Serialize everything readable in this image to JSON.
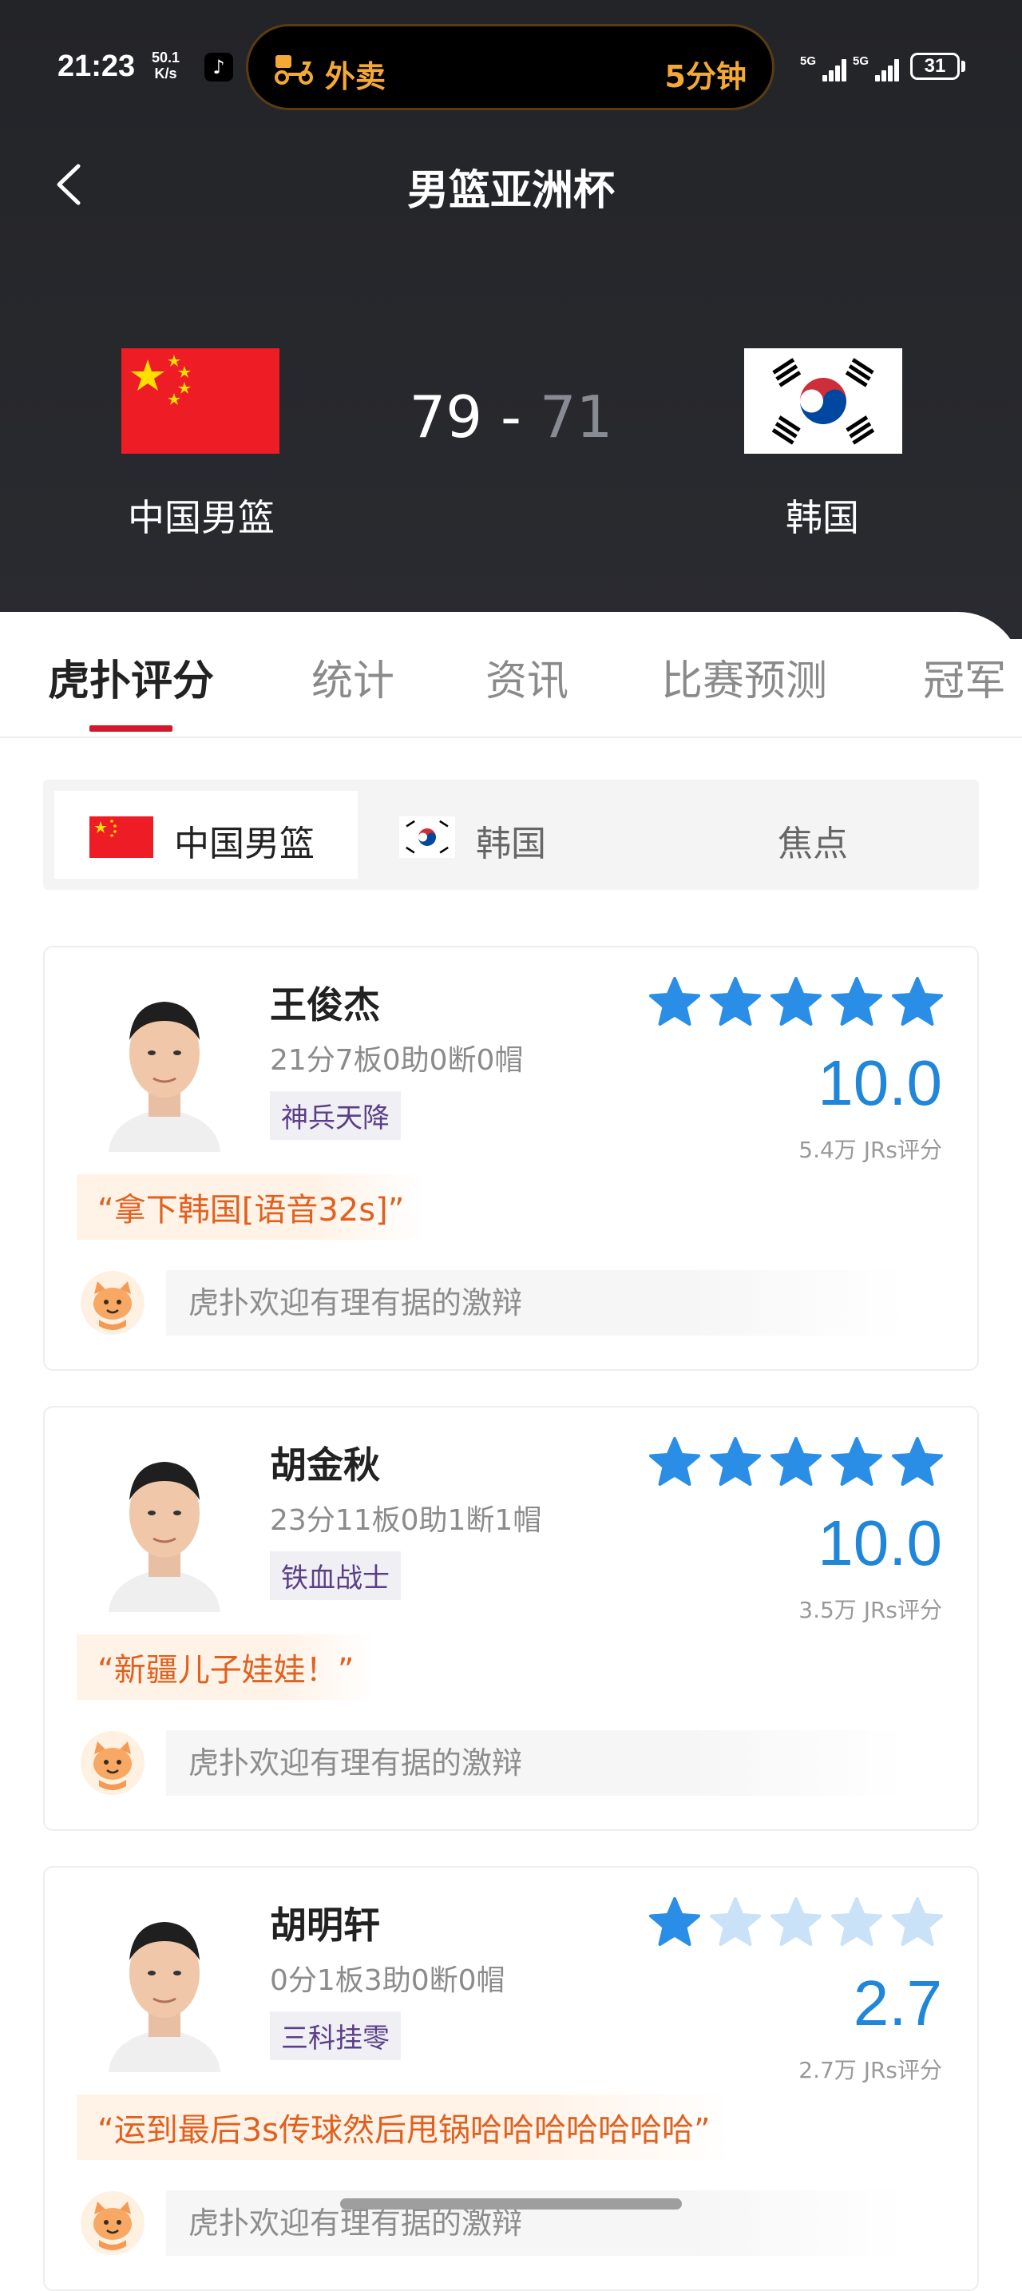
{
  "status_bar": {
    "time": "21:23",
    "net_speed_value": "50.1",
    "net_speed_unit": "K/s",
    "island_app": "外卖",
    "island_eta": "5分钟",
    "signal_1": "5G",
    "signal_2": "5G",
    "battery": "31"
  },
  "header": {
    "title": "男篮亚洲杯"
  },
  "match": {
    "home_team": "中国男篮",
    "away_team": "韩国",
    "home_score": "79",
    "separator": "-",
    "away_score": "71"
  },
  "tabs": [
    "虎扑评分",
    "统计",
    "资讯",
    "比赛预测",
    "冠军"
  ],
  "segments": [
    "中国男篮",
    "韩国",
    "焦点"
  ],
  "players": [
    {
      "name": "王俊杰",
      "stats": "21分7板0助0断0帽",
      "tag": "神兵天降",
      "stars": 5,
      "rating": "10.0",
      "rating_count": "5.4万 JRs评分",
      "quote": "“拿下韩国[语音32s]”",
      "comment_placeholder": "虎扑欢迎有理有据的激辩"
    },
    {
      "name": "胡金秋",
      "stats": "23分11板0助1断1帽",
      "tag": "铁血战士",
      "stars": 5,
      "rating": "10.0",
      "rating_count": "3.5万 JRs评分",
      "quote": "“新疆儿子娃娃！”",
      "comment_placeholder": "虎扑欢迎有理有据的激辩"
    },
    {
      "name": "胡明轩",
      "stats": "0分1板3助0断0帽",
      "tag": "三科挂零",
      "stars": 1,
      "rating": "2.7",
      "rating_count": "2.7万 JRs评分",
      "quote": "“运到最后3s传球然后甩锅哈哈哈哈哈哈哈”",
      "comment_placeholder": "虎扑欢迎有理有据的激辩"
    }
  ],
  "colors": {
    "accent_red": "#d3172c",
    "rating_blue": "#1f86d9",
    "star_full": "#2b8ee6",
    "star_empty": "#c9e2f7",
    "quote_orange": "#e0611f",
    "tag_purple": "#5a3f86"
  },
  "icons": {
    "back": "chevron-left-icon",
    "island": "scooter-icon",
    "star": "star-icon",
    "comment_avatar": "hupu-mascot-icon"
  }
}
